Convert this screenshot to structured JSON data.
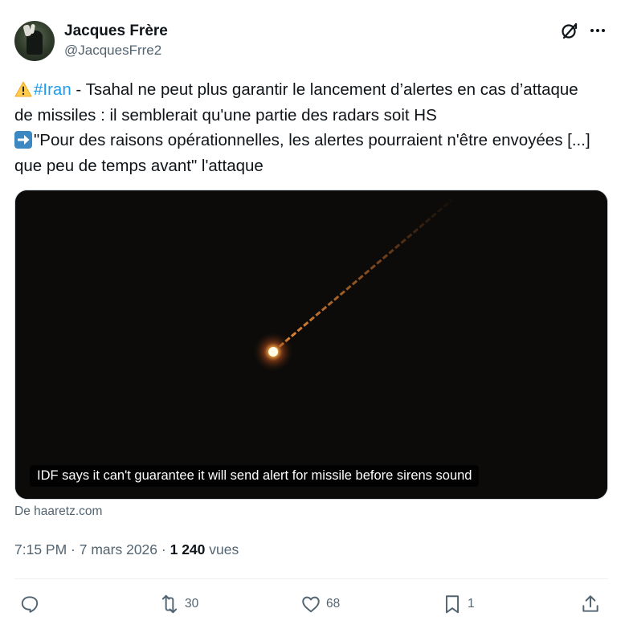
{
  "author": {
    "name": "Jacques Frère",
    "handle": "@JacquesFrre2"
  },
  "icons": {
    "grok": "grok-icon",
    "more": "more-icon",
    "warning_emoji": "warning-emoji-icon",
    "arrow_emoji": "right-arrow-emoji-icon",
    "reply": "reply-icon",
    "retweet": "retweet-icon",
    "like": "heart-icon",
    "bookmark": "bookmark-icon",
    "share": "share-icon"
  },
  "tweet": {
    "hashtag": "#Iran",
    "line1_rest": " - Tsahal ne peut plus garantir le lancement d’alertes en cas d’attaque de missiles : il semblerait qu'une partie des radars soit HS",
    "line2": "\"Pour des raisons opérationnelles, les alertes pourraient n'être envoyées [...] que peu de temps avant\" l'attaque"
  },
  "media": {
    "caption": "IDF says it can't guarantee it will send alert for missile before sirens sound",
    "source": "De haaretz.com"
  },
  "meta": {
    "time": "7:15 PM",
    "separator": " · ",
    "date": "7 mars 2026",
    "separator2": " · ",
    "views_count": "1 240",
    "views_label": " vues"
  },
  "actions": {
    "reply_count": "",
    "retweet_count": "30",
    "like_count": "68",
    "bookmark_count": "1"
  },
  "colors": {
    "accent": "#1d9bf0",
    "text": "#0f1419",
    "secondary": "#536471"
  }
}
